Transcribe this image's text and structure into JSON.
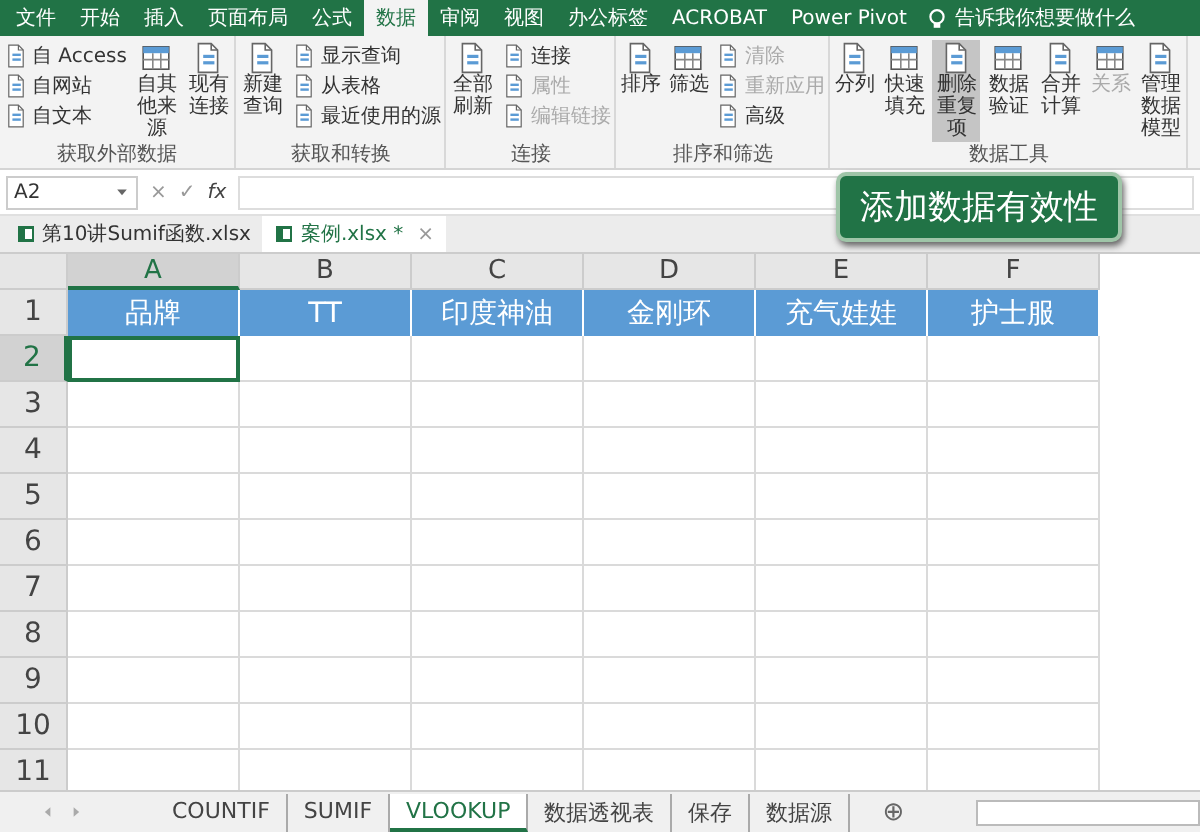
{
  "ribbon_tabs": [
    {
      "label": "文件",
      "selected": false
    },
    {
      "label": "开始",
      "selected": false
    },
    {
      "label": "插入",
      "selected": false
    },
    {
      "label": "页面布局",
      "selected": false
    },
    {
      "label": "公式",
      "selected": false
    },
    {
      "label": "数据",
      "selected": true
    },
    {
      "label": "审阅",
      "selected": false
    },
    {
      "label": "视图",
      "selected": false
    },
    {
      "label": "办公标签",
      "selected": false
    },
    {
      "label": "ACROBAT",
      "selected": false
    },
    {
      "label": "Power Pivot",
      "selected": false
    }
  ],
  "tell_me": "告诉我你想要做什么",
  "groups": [
    {
      "label": "获取外部数据",
      "columns": [
        {
          "kind": "stack",
          "items": [
            {
              "label": "自 Access",
              "disabled": false
            },
            {
              "label": "自网站",
              "disabled": false
            },
            {
              "label": "自文本",
              "disabled": false
            }
          ]
        },
        {
          "kind": "large",
          "items": [
            {
              "label": "自其他来源",
              "disabled": false,
              "hovered": false
            }
          ]
        },
        {
          "kind": "large",
          "items": [
            {
              "label": "现有连接",
              "disabled": false,
              "hovered": false
            }
          ]
        }
      ]
    },
    {
      "label": "获取和转换",
      "columns": [
        {
          "kind": "large",
          "items": [
            {
              "label": "新建查询",
              "disabled": false,
              "hovered": false
            }
          ]
        },
        {
          "kind": "stack",
          "items": [
            {
              "label": "显示查询",
              "disabled": false
            },
            {
              "label": "从表格",
              "disabled": false
            },
            {
              "label": "最近使用的源",
              "disabled": false
            }
          ]
        }
      ]
    },
    {
      "label": "连接",
      "columns": [
        {
          "kind": "large",
          "items": [
            {
              "label": "全部刷新",
              "disabled": false,
              "hovered": false
            }
          ]
        },
        {
          "kind": "stack",
          "items": [
            {
              "label": "连接",
              "disabled": false
            },
            {
              "label": "属性",
              "disabled": true
            },
            {
              "label": "编辑链接",
              "disabled": true
            }
          ]
        }
      ]
    },
    {
      "label": "排序和筛选",
      "columns": [
        {
          "kind": "large",
          "items": [
            {
              "label": "排序",
              "disabled": false,
              "hovered": false
            }
          ]
        },
        {
          "kind": "large",
          "items": [
            {
              "label": "筛选",
              "disabled": false,
              "hovered": false
            }
          ]
        },
        {
          "kind": "stack",
          "items": [
            {
              "label": "清除",
              "disabled": true
            },
            {
              "label": "重新应用",
              "disabled": true
            },
            {
              "label": "高级",
              "disabled": false
            }
          ]
        }
      ]
    },
    {
      "label": "数据工具",
      "columns": [
        {
          "kind": "large",
          "items": [
            {
              "label": "分列",
              "disabled": false,
              "hovered": false
            }
          ]
        },
        {
          "kind": "large",
          "items": [
            {
              "label": "快速填充",
              "disabled": false,
              "hovered": false
            }
          ]
        },
        {
          "kind": "large",
          "items": [
            {
              "label": "删除重复项",
              "disabled": false,
              "hovered": true
            }
          ]
        },
        {
          "kind": "large",
          "items": [
            {
              "label": "数据验证",
              "disabled": false,
              "hovered": false
            }
          ]
        },
        {
          "kind": "large",
          "items": [
            {
              "label": "合并计算",
              "disabled": false,
              "hovered": false
            }
          ]
        },
        {
          "kind": "large",
          "items": [
            {
              "label": "关系",
              "disabled": true,
              "hovered": false
            }
          ]
        },
        {
          "kind": "large",
          "items": [
            {
              "label": "管理数据模型",
              "disabled": false,
              "hovered": false
            }
          ]
        }
      ]
    }
  ],
  "tooltip": "添加数据有效性",
  "formula_bar": {
    "name_box": "A2",
    "cancel": "×",
    "enter": "✓",
    "function": "fx"
  },
  "workbook_tabs": [
    {
      "label": "第10讲Sumif函数.xlsx",
      "selected": false
    },
    {
      "label": "案例.xlsx *",
      "selected": true
    }
  ],
  "workbook_close": "×",
  "sheet": {
    "columns": [
      {
        "label": "A",
        "selected": true
      },
      {
        "label": "B",
        "selected": false
      },
      {
        "label": "C",
        "selected": false
      },
      {
        "label": "D",
        "selected": false
      },
      {
        "label": "E",
        "selected": false
      },
      {
        "label": "F",
        "selected": false
      }
    ],
    "rows": [
      {
        "label": "1",
        "selected": false,
        "kind": "header",
        "cells": [
          "品牌",
          "TT",
          "印度神油",
          "金刚环",
          "充气娃娃",
          "护士服"
        ]
      },
      {
        "label": "2",
        "selected": true
      },
      {
        "label": "3",
        "selected": false
      },
      {
        "label": "4",
        "selected": false
      },
      {
        "label": "5",
        "selected": false
      },
      {
        "label": "6",
        "selected": false
      },
      {
        "label": "7",
        "selected": false
      },
      {
        "label": "8",
        "selected": false
      },
      {
        "label": "9",
        "selected": false
      },
      {
        "label": "10",
        "selected": false
      },
      {
        "label": "11",
        "selected": false
      }
    ]
  },
  "sheet_tabs": [
    {
      "label": "COUNTIF",
      "selected": false
    },
    {
      "label": "SUMIF",
      "selected": false
    },
    {
      "label": "VLOOKUP",
      "selected": true
    },
    {
      "label": "数据透视表",
      "selected": false
    },
    {
      "label": "保存",
      "selected": false
    },
    {
      "label": "数据源",
      "selected": false
    }
  ],
  "add_sheet": "⊕"
}
